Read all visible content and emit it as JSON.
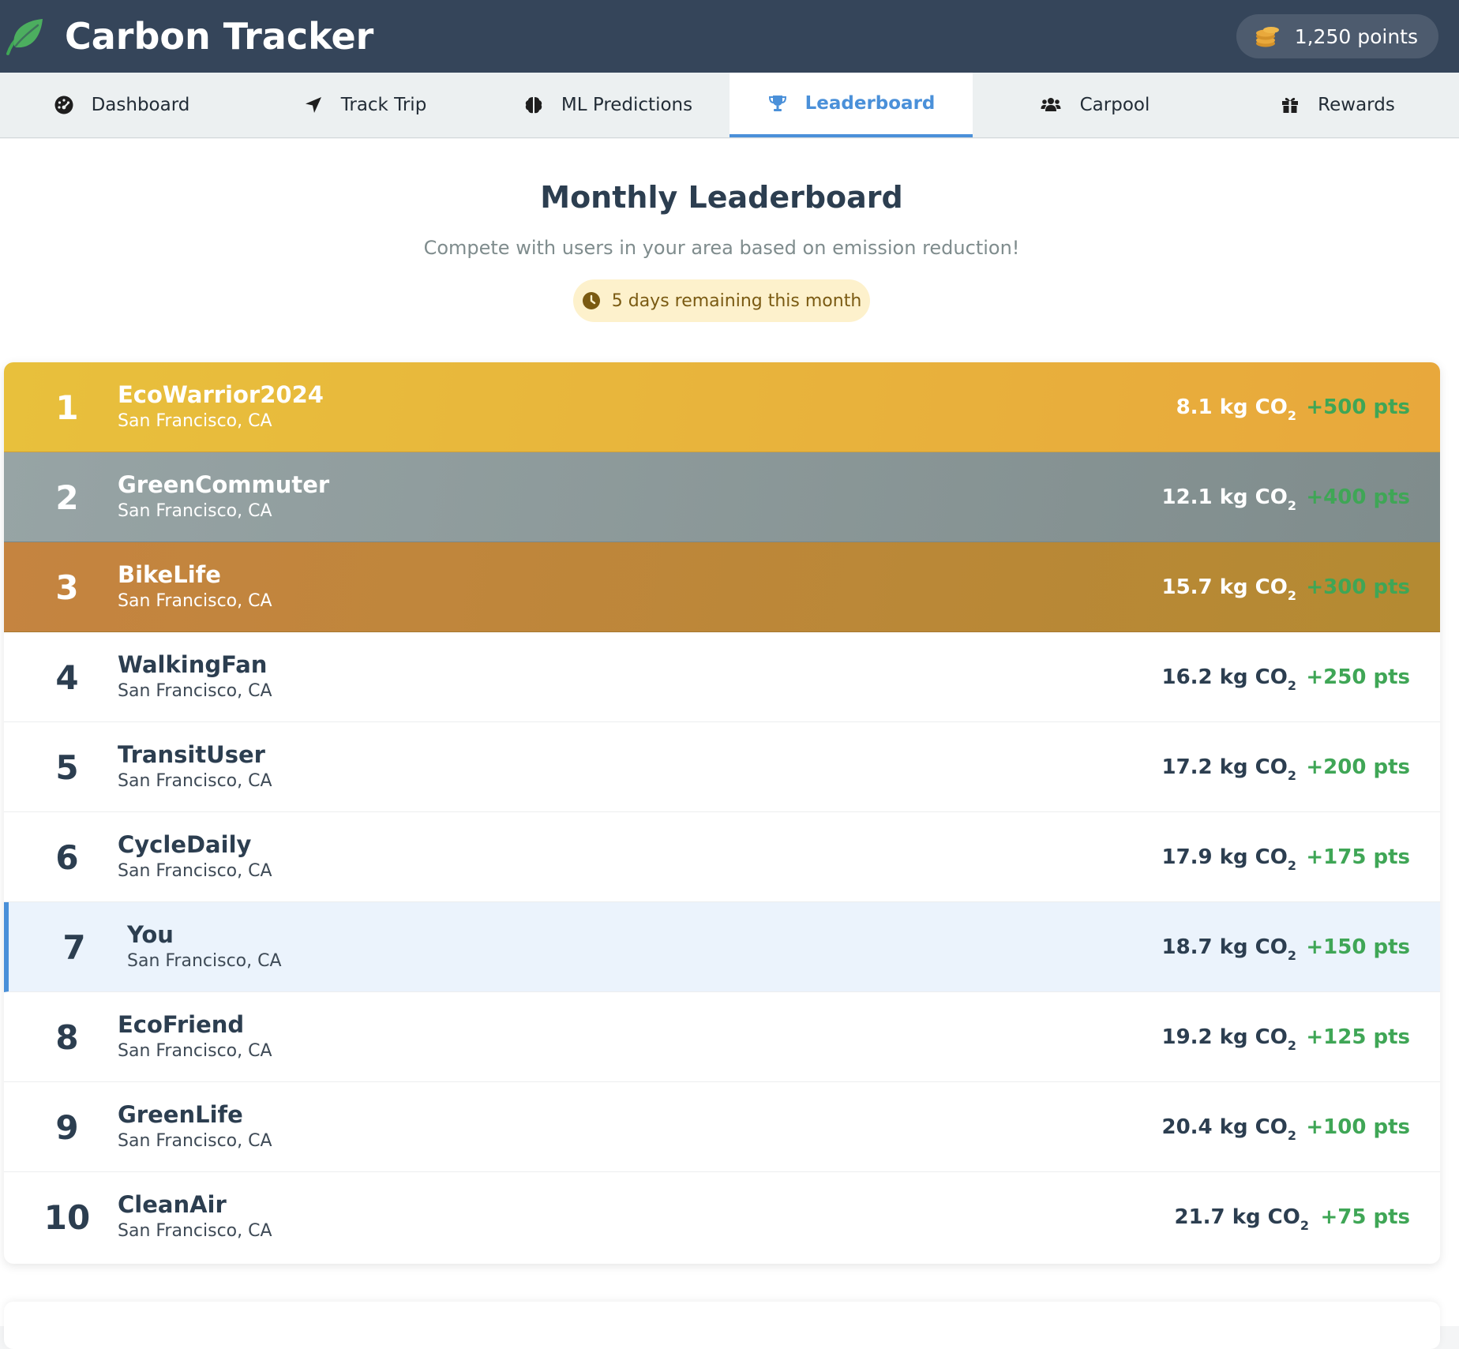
{
  "app": {
    "title": "Carbon Tracker",
    "points_label": "1,250 points",
    "icons": {
      "logo": "leaf-icon",
      "points": "coins-icon"
    },
    "colors": {
      "header_bg": "#35455a",
      "accent": "#4a90d9",
      "reward_green": "#3fa656"
    }
  },
  "tabs": [
    {
      "label": "Dashboard",
      "icon": "dashboard-gauge-icon",
      "active": false
    },
    {
      "label": "Track Trip",
      "icon": "location-arrow-icon",
      "active": false
    },
    {
      "label": "ML Predictions",
      "icon": "brain-icon",
      "active": false
    },
    {
      "label": "Leaderboard",
      "icon": "trophy-icon",
      "active": true
    },
    {
      "label": "Carpool",
      "icon": "users-icon",
      "active": false
    },
    {
      "label": "Rewards",
      "icon": "gift-icon",
      "active": false
    }
  ],
  "leaderboard": {
    "heading": "Monthly Leaderboard",
    "subtitle": "Compete with users in your area based on emission reduction!",
    "countdown": "5 days remaining this month",
    "countdown_icon": "clock-icon",
    "co2_unit": "kg CO",
    "co2_subscript": "2",
    "rows": [
      {
        "rank": "1",
        "name": "EcoWarrior2024",
        "location": "San Francisco, CA",
        "emissions": "8.1",
        "points": "+500 pts",
        "tier": "gold"
      },
      {
        "rank": "2",
        "name": "GreenCommuter",
        "location": "San Francisco, CA",
        "emissions": "12.1",
        "points": "+400 pts",
        "tier": "silver"
      },
      {
        "rank": "3",
        "name": "BikeLife",
        "location": "San Francisco, CA",
        "emissions": "15.7",
        "points": "+300 pts",
        "tier": "bronze"
      },
      {
        "rank": "4",
        "name": "WalkingFan",
        "location": "San Francisco, CA",
        "emissions": "16.2",
        "points": "+250 pts",
        "tier": ""
      },
      {
        "rank": "5",
        "name": "TransitUser",
        "location": "San Francisco, CA",
        "emissions": "17.2",
        "points": "+200 pts",
        "tier": ""
      },
      {
        "rank": "6",
        "name": "CycleDaily",
        "location": "San Francisco, CA",
        "emissions": "17.9",
        "points": "+175 pts",
        "tier": ""
      },
      {
        "rank": "7",
        "name": "You",
        "location": "San Francisco, CA",
        "emissions": "18.7",
        "points": "+150 pts",
        "tier": "current-user"
      },
      {
        "rank": "8",
        "name": "EcoFriend",
        "location": "San Francisco, CA",
        "emissions": "19.2",
        "points": "+125 pts",
        "tier": ""
      },
      {
        "rank": "9",
        "name": "GreenLife",
        "location": "San Francisco, CA",
        "emissions": "20.4",
        "points": "+100 pts",
        "tier": ""
      },
      {
        "rank": "10",
        "name": "CleanAir",
        "location": "San Francisco, CA",
        "emissions": "21.7",
        "points": "+75 pts",
        "tier": ""
      }
    ]
  }
}
